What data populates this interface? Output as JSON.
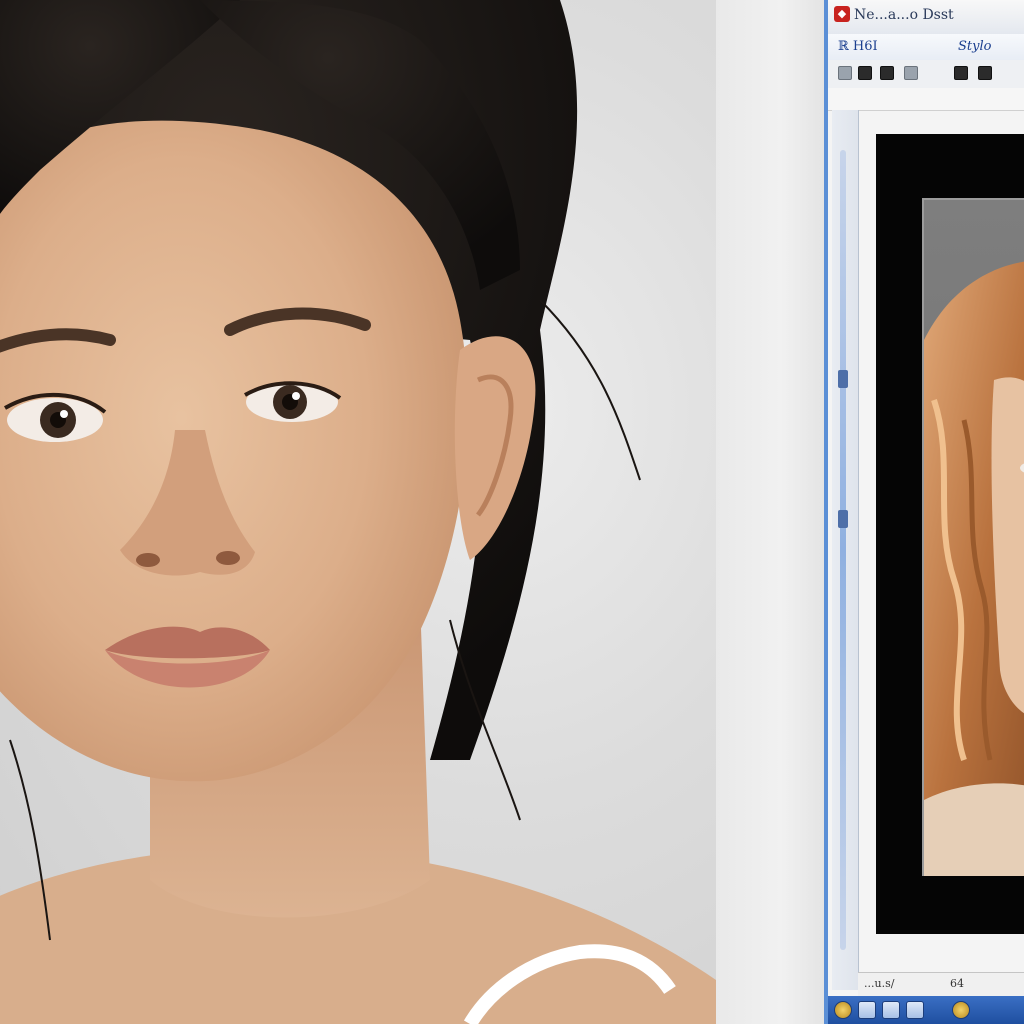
{
  "window": {
    "title": "Ne...a...o Dsst",
    "menu_left": "ℝ H6I",
    "menu_right": "Stylo",
    "status_text": "...u.s/",
    "status_num": "64"
  },
  "icons": {
    "app": "app-icon",
    "toolbar": [
      "stop-icon",
      "record-icon",
      "grid-icon",
      "tool-icon",
      "image-icon",
      "list-icon"
    ],
    "taskbar": [
      "start-icon",
      "folder-icon",
      "browser-icon",
      "app-icon",
      "media-icon"
    ]
  },
  "colors": {
    "window_border": "#5b8fd6",
    "taskbar": "#2b5fb4",
    "canvas": "#050505"
  }
}
